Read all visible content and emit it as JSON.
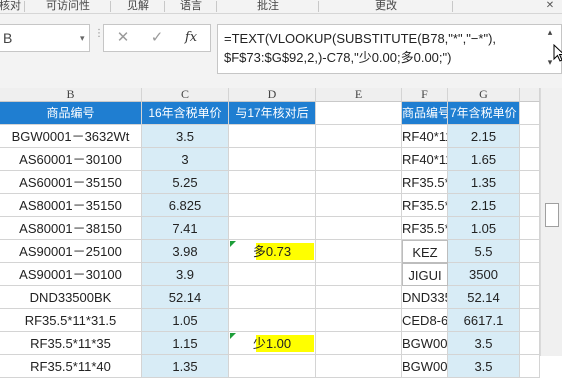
{
  "ribbon": {
    "groups": [
      "核对",
      "可访问性",
      "见解",
      "语言",
      "批注",
      "更改"
    ],
    "close_glyph": "✕"
  },
  "formula_bar": {
    "name_box": "B",
    "name_box_arrow": "▾",
    "cancel_icon": "✕",
    "enter_icon": "✓",
    "fx_icon": "fx",
    "formula_line1": "=TEXT(VLOOKUP(SUBSTITUTE(B78,\"*\",\"−*\"),",
    "formula_line2": "$F$73:$G$92,2,)-C78,\"少0.00;多0.00;\")",
    "scroll_up": "▴",
    "scroll_down": "▾"
  },
  "columns": [
    "B",
    "C",
    "D",
    "E",
    "F",
    "G"
  ],
  "headers": {
    "b": "商品编号",
    "c": "16年含税单价",
    "d": "与17年核对后",
    "f": "商品编号",
    "g": "7年含税单价"
  },
  "rows": [
    {
      "b": "BGW0001－3632Wt",
      "c": "3.5",
      "d": "",
      "f": "RF40*11*",
      "g": "2.15"
    },
    {
      "b": "AS60001－30100",
      "c": "3",
      "d": "",
      "f": "RF40*11*",
      "g": "1.65"
    },
    {
      "b": "AS60001－35150",
      "c": "5.25",
      "d": "",
      "f": "RF35.5*11",
      "g": "1.35"
    },
    {
      "b": "AS80001－35150",
      "c": "6.825",
      "d": "",
      "f": "RF35.5*11",
      "g": "2.15"
    },
    {
      "b": "AS80001－38150",
      "c": "7.41",
      "d": "",
      "f": "RF35.5*11*1",
      "g": "1.05"
    },
    {
      "b": "AS90001－25100",
      "c": "3.98",
      "d": "多0.73",
      "f": "KEZ",
      "g": "5.5"
    },
    {
      "b": "AS90001－30100",
      "c": "3.9",
      "d": "",
      "f": "JIGUI",
      "g": "3500"
    },
    {
      "b": "DND33500BK",
      "c": "52.14",
      "d": "",
      "f": "DND3350",
      "g": "52.14"
    },
    {
      "b": "RF35.5*11*31.5",
      "c": "1.05",
      "d": "",
      "f": "CED8-645*3",
      "g": "6617.1"
    },
    {
      "b": "RF35.5*11*35",
      "c": "1.15",
      "d": "少1.00",
      "f": "BGW0001－3",
      "g": "3.5"
    },
    {
      "b": "RF35.5*11*40",
      "c": "1.35",
      "d": "",
      "f": "BGW0001－3",
      "g": "3.5"
    }
  ],
  "colors": {
    "header_blue": "#1f7ed1",
    "value_column_bg": "#d8ecf6",
    "highlight_yellow": "#ffff00",
    "error_triangle": "#1e9e3a"
  }
}
